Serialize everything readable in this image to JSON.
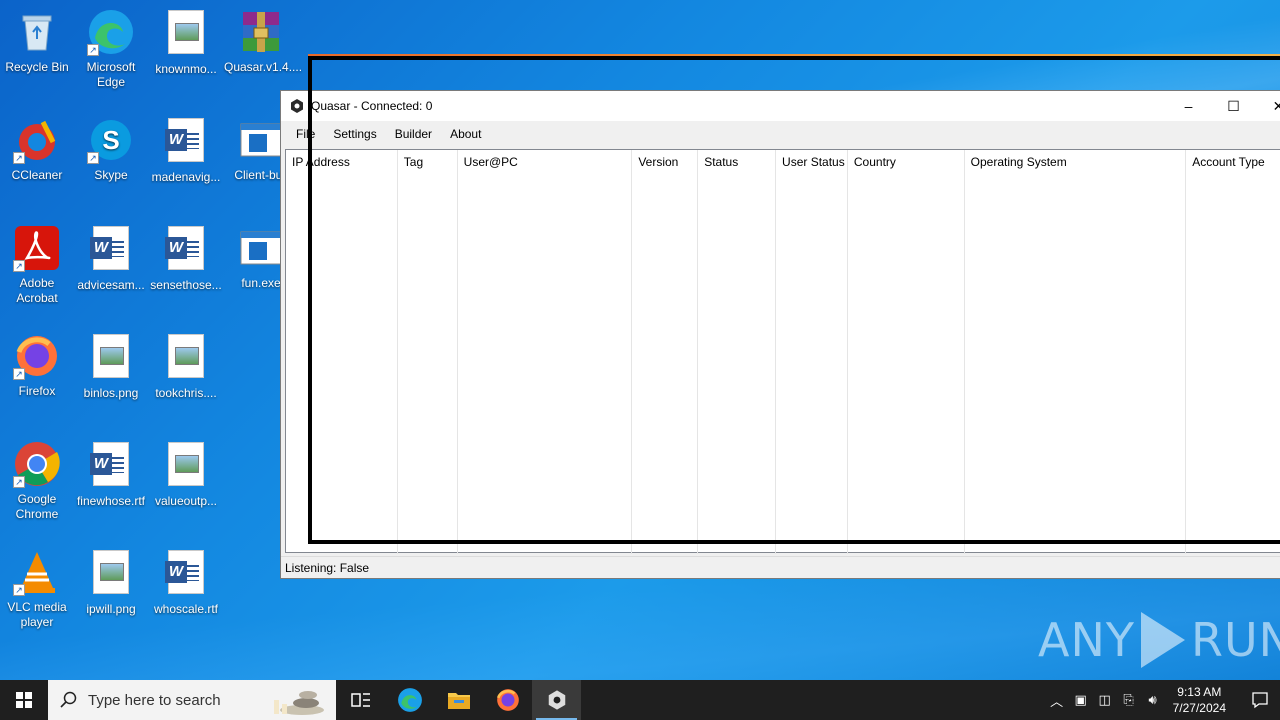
{
  "desktop": {
    "icons": [
      {
        "label": "Recycle Bin",
        "icon": "recycle-bin-icon"
      },
      {
        "label": "Microsoft Edge",
        "icon": "edge-icon"
      },
      {
        "label": "knownmo...",
        "icon": "image-file-icon"
      },
      {
        "label": "Quasar.v1.4....",
        "icon": "winrar-archive-icon"
      },
      {
        "label": "CCleaner",
        "icon": "ccleaner-icon"
      },
      {
        "label": "Skype",
        "icon": "skype-icon"
      },
      {
        "label": "madenavig...",
        "icon": "word-document-icon"
      },
      {
        "label": "Client-buil",
        "icon": "executable-icon"
      },
      {
        "label": "Adobe Acrobat",
        "icon": "acrobat-icon"
      },
      {
        "label": "advicesam...",
        "icon": "word-document-icon"
      },
      {
        "label": "sensethose...",
        "icon": "word-document-icon"
      },
      {
        "label": "fun.exe",
        "icon": "executable-icon"
      },
      {
        "label": "Firefox",
        "icon": "firefox-icon"
      },
      {
        "label": "binlos.png",
        "icon": "image-file-icon"
      },
      {
        "label": "tookchris....",
        "icon": "image-file-icon"
      },
      {
        "label": "Google Chrome",
        "icon": "chrome-icon"
      },
      {
        "label": "finewhose.rtf",
        "icon": "word-document-icon"
      },
      {
        "label": "valueoutp...",
        "icon": "image-file-icon"
      },
      {
        "label": "VLC media player",
        "icon": "vlc-icon"
      },
      {
        "label": "ipwill.png",
        "icon": "image-file-icon"
      },
      {
        "label": "whoscale.rtf",
        "icon": "word-document-icon"
      }
    ]
  },
  "window": {
    "title": "Quasar - Connected: 0",
    "controls": {
      "minimize": "–",
      "maximize": "☐",
      "close": "✕"
    },
    "menu": [
      "File",
      "Settings",
      "Builder",
      "About"
    ],
    "columns": [
      "IP Address",
      "Tag",
      "User@PC",
      "Version",
      "Status",
      "User Status",
      "Country",
      "Operating System",
      "Account Type"
    ],
    "rows": [],
    "status": "Listening: False"
  },
  "watermark": {
    "left": "ANY",
    "right": "RUN"
  },
  "taskbar": {
    "search_placeholder": "Type here to search",
    "apps": [
      "task-view-icon",
      "edge-icon",
      "file-explorer-icon",
      "firefox-icon",
      "quasar-icon"
    ],
    "active_app": "quasar-icon",
    "clock_time": "9:13 AM",
    "clock_date": "7/27/2024"
  },
  "colors": {
    "desktop": "#0f7fd6",
    "taskbar": "#1f1f1f",
    "highlight_orange": "#e8692b"
  }
}
